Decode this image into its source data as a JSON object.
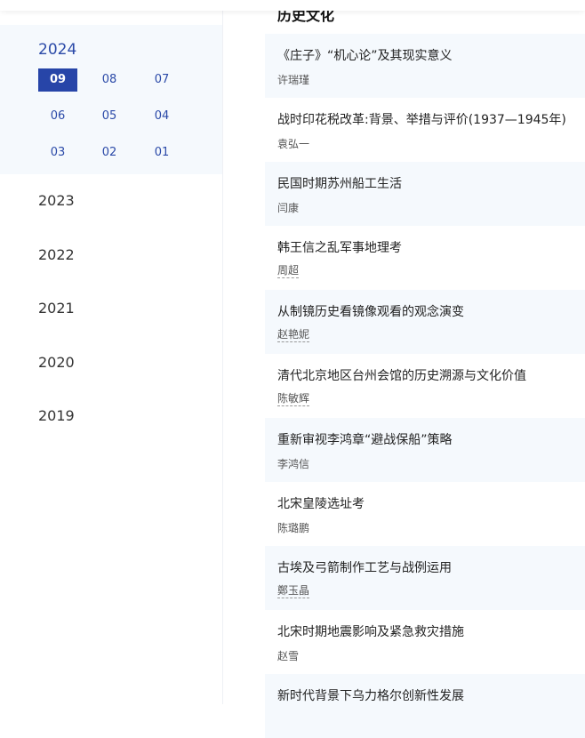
{
  "section_title": "历史文化",
  "current_year": "2024",
  "months": [
    "09",
    "08",
    "07",
    "06",
    "05",
    "04",
    "03",
    "02",
    "01"
  ],
  "active_month": "09",
  "years": [
    "2023",
    "2022",
    "2021",
    "2020",
    "2019"
  ],
  "articles": [
    {
      "title": "《庄子》“机心论”及其现实意义",
      "author": "许瑞瑾"
    },
    {
      "title": "战时印花税改革:背景、举措与评价(1937—1945年)",
      "author": "袁弘一"
    },
    {
      "title": "民国时期苏州船工生活",
      "author": "闫康"
    },
    {
      "title": "韩王信之乱军事地理考",
      "author": "周超"
    },
    {
      "title": "从制镜历史看镜像观看的观念演变",
      "author": "赵艳妮"
    },
    {
      "title": "清代北京地区台州会馆的历史溯源与文化价值",
      "author": "陈敏辉"
    },
    {
      "title": "重新审视李鸿章“避战保船”策略",
      "author": "李鸿信"
    },
    {
      "title": "北宋皇陵选址考",
      "author": "陈璐鹏"
    },
    {
      "title": "古埃及弓箭制作工艺与战例运用",
      "author": "鄭玉晶"
    },
    {
      "title": "北宋时期地震影响及紧急救灾措施",
      "author": "赵雪"
    },
    {
      "title": "新时代背景下乌力格尔创新性发展",
      "author": ""
    }
  ]
}
